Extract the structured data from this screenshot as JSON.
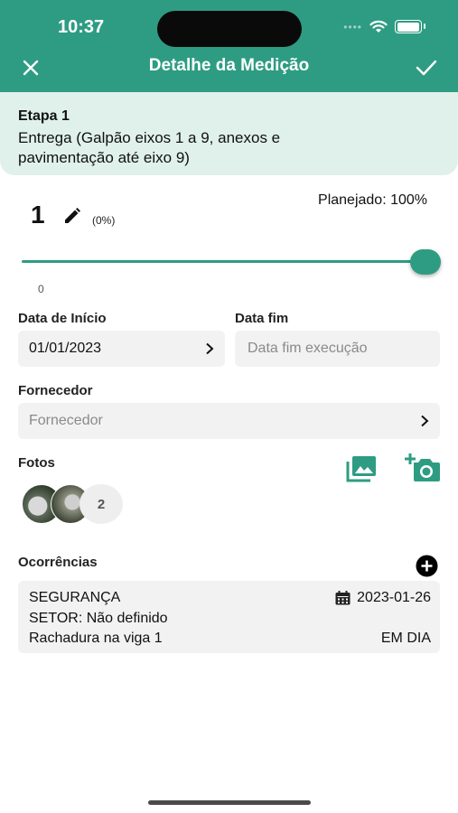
{
  "status_bar": {
    "time": "10:37"
  },
  "header": {
    "title": "Detalhe da Medição"
  },
  "stage": {
    "title": "Etapa 1",
    "description": "Entrega (Galpão eixos 1 a 9, anexos e pavimentação até eixo 9)"
  },
  "progress": {
    "quantity": "1",
    "percent_label": "(0%)",
    "planned_label": "Planejado: 100%",
    "slider_min_label": "0",
    "slider_value": 1.0
  },
  "dates": {
    "start_label": "Data de Início",
    "start_value": "01/01/2023",
    "end_label": "Data fim",
    "end_placeholder": "Data fim execução"
  },
  "supplier": {
    "label": "Fornecedor",
    "placeholder": "Fornecedor"
  },
  "photos": {
    "label": "Fotos",
    "count": "2"
  },
  "occurrences": {
    "label": "Ocorrências",
    "items": [
      {
        "type": "SEGURANÇA",
        "date": "2023-01-26",
        "sector": "SETOR: Não definido",
        "description": "Rachadura na viga 1",
        "status": "EM DIA"
      }
    ]
  },
  "colors": {
    "primary": "#2e9c82",
    "stage_bg": "#e0f1ec",
    "field_bg": "#f2f2f2"
  },
  "icons": [
    "close-icon",
    "check-icon",
    "pencil-icon",
    "chevron-right-icon",
    "gallery-icon",
    "camera-add-icon",
    "add-circle-icon",
    "calendar-icon",
    "wifi-icon",
    "battery-icon"
  ]
}
